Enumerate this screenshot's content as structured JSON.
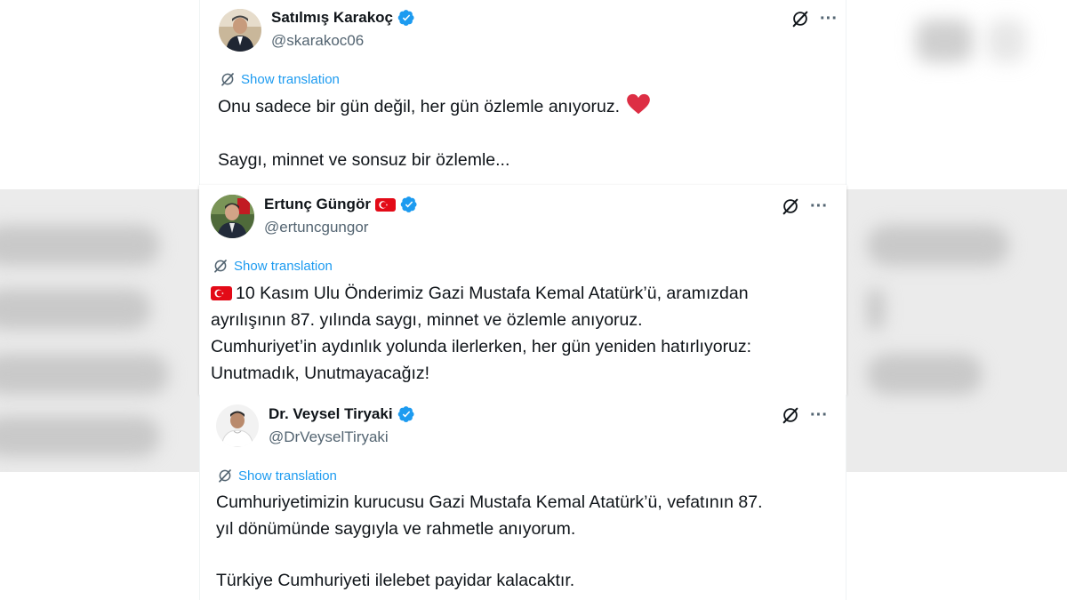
{
  "colors": {
    "accent": "#1d9bf0",
    "text": "#0f1419",
    "muted": "#536471",
    "heart": "#e0245e",
    "flag_red": "#e30a17"
  },
  "tweets": [
    {
      "name": "Satılmış Karakoç",
      "handle": "@skarakoc06",
      "verified": true,
      "translate_label": "Show translation",
      "lines": [
        "Onu sadece bir gün değil, her gün özlemle anıyoruz.",
        "",
        "Saygı, minnet ve sonsuz bir özlemle..."
      ],
      "emoji": "red-heart-emoji"
    },
    {
      "name": "Ertunç Güngör",
      "handle": "@ertuncgungor",
      "verified": true,
      "name_flag": "turkey-flag-icon",
      "translate_label": "Show translation",
      "lines": [
        "10 Kasım Ulu Önderimiz Gazi Mustafa Kemal Atatürk’ü, aramızdan",
        "ayrılışının 87. yılında saygı, minnet ve özlemle anıyoruz.",
        "Cumhuriyet’in aydınlık yolunda ilerlerken, her gün yeniden hatırlıyoruz:",
        "Unutmadık, Unutmayacağız!"
      ]
    },
    {
      "name": "Dr. Veysel Tiryaki",
      "handle": "@DrVeyselTiryaki",
      "verified": true,
      "translate_label": "Show translation",
      "lines": [
        "Cumhuriyetimizin kurucusu Gazi Mustafa Kemal Atatürk’ü, vefatının 87.",
        "yıl dönümünde saygıyla ve rahmetle anıyorum.",
        "",
        "Türkiye Cumhuriyeti ilelebet payidar kalacaktır."
      ]
    }
  ],
  "icons": {
    "grok": "grok-icon",
    "more": "more-options-icon",
    "verified": "verified-badge-icon",
    "translate": "translate-icon"
  },
  "more_glyph": "···"
}
